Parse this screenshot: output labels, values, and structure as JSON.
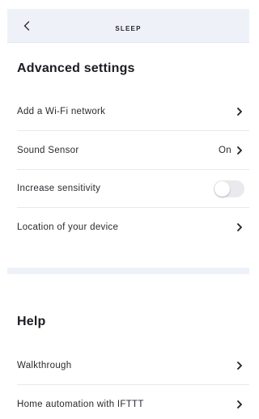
{
  "header": {
    "title": "SLEEP",
    "back_icon": "chevron-left-icon"
  },
  "advanced": {
    "title": "Advanced settings",
    "items": [
      {
        "label": "Add a Wi-Fi network",
        "icon": "chevron-right-icon"
      },
      {
        "label": "Sound Sensor",
        "value": "On",
        "icon": "chevron-right-icon"
      },
      {
        "label": "Increase sensitivity",
        "toggle": false
      },
      {
        "label": "Location of your device",
        "icon": "chevron-right-icon"
      }
    ]
  },
  "help": {
    "title": "Help",
    "items": [
      {
        "label": "Walkthrough",
        "icon": "chevron-right-icon"
      },
      {
        "label": "Home automation with IFTTT",
        "icon": "chevron-right-icon"
      }
    ]
  },
  "colors": {
    "header_bg": "#eef2f8",
    "toggle_off": "#e9e9ee",
    "text": "#1f1f24"
  }
}
